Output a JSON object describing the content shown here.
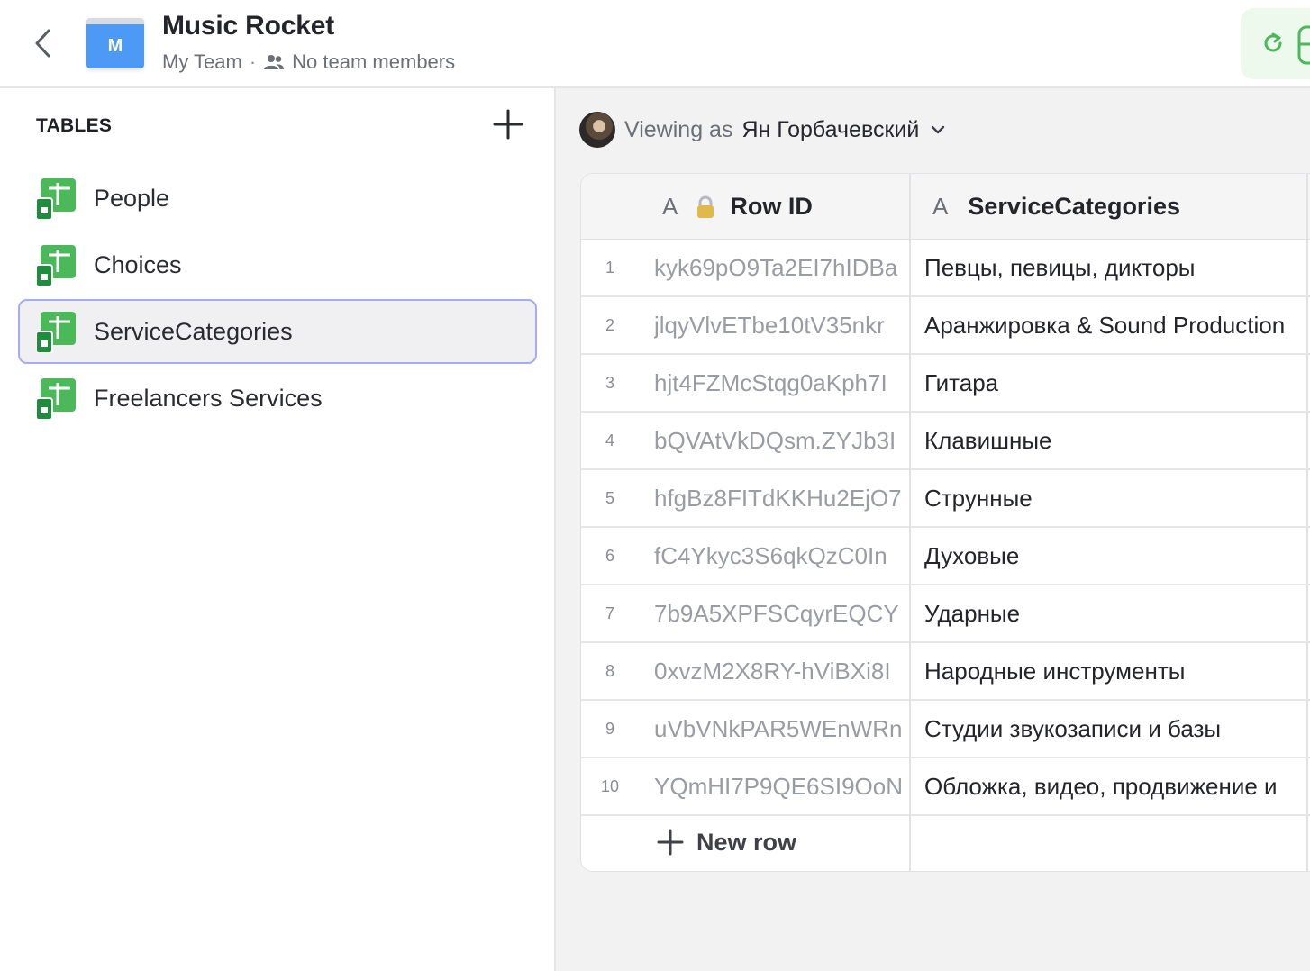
{
  "header": {
    "app_icon_letter": "M",
    "app_title": "Music Rocket",
    "team": "My Team",
    "separator": "·",
    "members": "No team members"
  },
  "sidebar": {
    "heading": "TABLES",
    "items": [
      {
        "label": "People",
        "selected": false
      },
      {
        "label": "Choices",
        "selected": false
      },
      {
        "label": "ServiceCategories",
        "selected": true
      },
      {
        "label": "Freelancers Services",
        "selected": false
      }
    ]
  },
  "main": {
    "viewing_label": "Viewing as",
    "viewing_user": "Ян Горбачевский",
    "columns": [
      {
        "type_letter": "A",
        "label": "Row ID",
        "locked": true
      },
      {
        "type_letter": "A",
        "label": "ServiceCategories",
        "locked": false
      }
    ],
    "rows": [
      {
        "num": "1",
        "row_id": "kyk69pO9Ta2EI7hIDBa",
        "category": "Певцы, певицы, дикторы"
      },
      {
        "num": "2",
        "row_id": "jlqyVlvETbe10tV35nkr",
        "category": "Аранжировка & Sound Production"
      },
      {
        "num": "3",
        "row_id": "hjt4FZMcStqg0aKph7I",
        "category": "Гитара"
      },
      {
        "num": "4",
        "row_id": "bQVAtVkDQsm.ZYJb3I",
        "category": "Клавишные"
      },
      {
        "num": "5",
        "row_id": "hfgBz8FITdKKHu2EjO7",
        "category": "Струнные"
      },
      {
        "num": "6",
        "row_id": "fC4Ykyc3S6qkQzC0In",
        "category": "Духовые"
      },
      {
        "num": "7",
        "row_id": "7b9A5XPFSCqyrEQCY",
        "category": "Ударные"
      },
      {
        "num": "8",
        "row_id": "0xvzM2X8RY-hViBXi8I",
        "category": "Народные инструменты"
      },
      {
        "num": "9",
        "row_id": "uVbVNkPAR5WEnWRn",
        "category": "Студии звукозаписи и базы"
      },
      {
        "num": "10",
        "row_id": "YQmHI7P9QE6SI9OoN",
        "category": "Обложка, видео, продвижение и"
      }
    ],
    "new_row_label": "New row"
  },
  "colors": {
    "accent_green": "#4bb85a",
    "selected_border": "#a6aaf2",
    "app_icon_blue": "#4c99f6"
  }
}
